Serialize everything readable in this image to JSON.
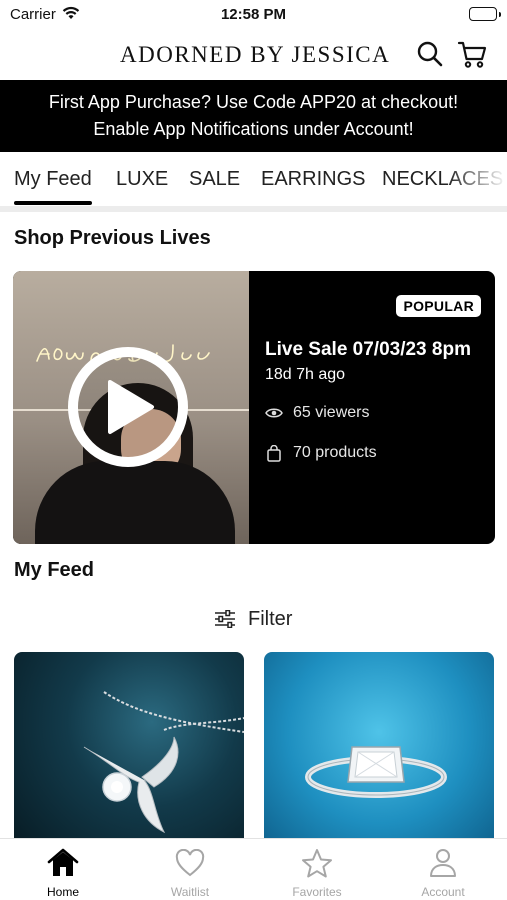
{
  "status_bar": {
    "carrier": "Carrier",
    "time": "12:58 PM",
    "icons": [
      "wifi-icon",
      "battery-icon"
    ]
  },
  "header": {
    "brand": "ADORNED BY JESSICA",
    "icons": [
      "search-icon",
      "cart-icon"
    ]
  },
  "promo": {
    "line1": "First App Purchase? Use Code APP20 at checkout!",
    "line2": "Enable App Notifications under Account!"
  },
  "tabs": [
    {
      "label": "My Feed",
      "active": true
    },
    {
      "label": "LUXE",
      "active": false
    },
    {
      "label": "SALE",
      "active": false
    },
    {
      "label": "EARRINGS",
      "active": false
    },
    {
      "label": "NECKLACES",
      "active": false
    }
  ],
  "previous_lives": {
    "section_title": "Shop Previous Lives",
    "card": {
      "badge": "POPULAR",
      "title": "Live Sale 07/03/23 8pm",
      "ago": "18d 7h ago",
      "viewers": "65 viewers",
      "products": "70 products",
      "sign_text": "Adorned by Jessica"
    }
  },
  "feed": {
    "section_title": "My Feed",
    "filter_label": "Filter",
    "products": [
      {
        "name": "angel-wing-pendant-necklace"
      },
      {
        "name": "princess-cut-diamond-ring"
      }
    ]
  },
  "tab_bar": {
    "items": [
      {
        "label": "Home",
        "icon": "home-icon",
        "active": true
      },
      {
        "label": "Waitlist",
        "icon": "heart-icon",
        "active": false
      },
      {
        "label": "Favorites",
        "icon": "star-icon",
        "active": false
      },
      {
        "label": "Account",
        "icon": "person-icon",
        "active": false
      }
    ]
  },
  "colors": {
    "promo_bg": "#000000",
    "text": "#111111",
    "inactive_tab": "#a6a6a6"
  }
}
